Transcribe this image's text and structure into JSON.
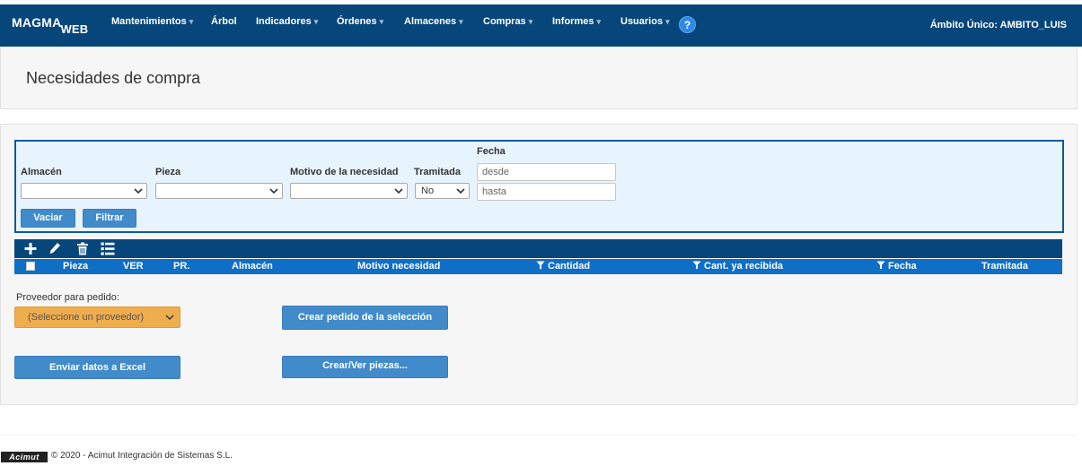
{
  "app": {
    "logo_main": "MAGMA",
    "logo_sub": "WEB",
    "ambito": "Ámbito Único: AMBITO_LUIS"
  },
  "nav": {
    "items": [
      {
        "label": "Mantenimientos",
        "dropdown": true
      },
      {
        "label": "Árbol",
        "dropdown": false
      },
      {
        "label": "Indicadores",
        "dropdown": true
      },
      {
        "label": "Órdenes",
        "dropdown": true
      },
      {
        "label": "Almacenes",
        "dropdown": true
      },
      {
        "label": "Compras",
        "dropdown": true
      },
      {
        "label": "Informes",
        "dropdown": true
      },
      {
        "label": "Usuarios",
        "dropdown": true
      }
    ],
    "help_label": "?"
  },
  "page": {
    "title": "Necesidades de compra"
  },
  "filters": {
    "almacen_label": "Almacén",
    "almacen_value": "",
    "pieza_label": "Pieza",
    "pieza_value": "",
    "motivo_label": "Motivo de la necesidad",
    "motivo_value": "",
    "tramitada_label": "Tramitada",
    "tramitada_value": "No",
    "fecha_label": "Fecha",
    "desde_placeholder": "desde",
    "hasta_placeholder": "hasta",
    "vaciar_label": "Vaciar",
    "filtrar_label": "Filtrar"
  },
  "toolbar": {
    "icons": [
      "plus-icon",
      "pencil-icon",
      "trash-icon",
      "list-icon"
    ]
  },
  "table": {
    "columns": {
      "pieza": "Pieza",
      "ver": "VER",
      "pr": "PR.",
      "almacen": "Almacén",
      "motivo": "Motivo necesidad",
      "cantidad": "Cantidad",
      "recibida": "Cant. ya recibida",
      "fecha": "Fecha",
      "tramitada": "Tramitada"
    },
    "rows": []
  },
  "actions": {
    "proveedor_label": "Proveedor para pedido:",
    "proveedor_value": "(Seleccione un proveedor)",
    "crear_pedido_label": "Crear pedido de la selección",
    "excel_label": "Enviar datos a Excel",
    "crear_piezas_label": "Crear/Ver piezas..."
  },
  "footer": {
    "logo_text": "Acimut",
    "copyright": "© 2020 - Acimut Integración de Sistemas S.L."
  },
  "colors": {
    "navbar": "#07467a",
    "accent": "#428bca",
    "table_header": "#0f6fc6",
    "proveedor_select": "#f0ad4e",
    "filter_bg": "#e8f4fd"
  }
}
